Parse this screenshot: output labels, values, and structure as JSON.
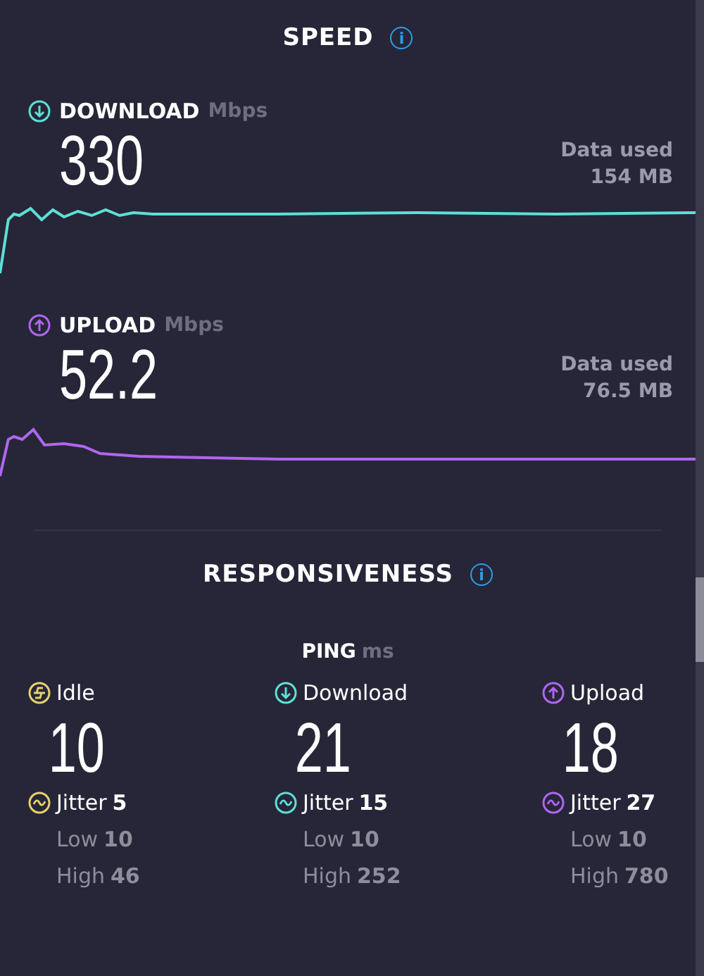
{
  "speed": {
    "title": "SPEED",
    "info": "i",
    "tests": [
      {
        "kind": "download",
        "label": "DOWNLOAD",
        "unit": "Mbps",
        "value": "330",
        "data_used_label": "Data used",
        "data_used": "154 MB",
        "color": "#5ee0d6"
      },
      {
        "kind": "upload",
        "label": "UPLOAD",
        "unit": "Mbps",
        "value": "52.2",
        "data_used_label": "Data used",
        "data_used": "76.5 MB",
        "color": "#b066ee"
      }
    ]
  },
  "responsiveness": {
    "title": "RESPONSIVENESS",
    "info": "i",
    "ping_label": "PING",
    "ping_unit": "ms",
    "columns": [
      {
        "kind": "idle",
        "label": "Idle",
        "value": "10",
        "jitter_label": "Jitter",
        "jitter": "5",
        "low_label": "Low",
        "low": "10",
        "high_label": "High",
        "high": "46",
        "color": "#e6d36a"
      },
      {
        "kind": "download",
        "label": "Download",
        "value": "21",
        "jitter_label": "Jitter",
        "jitter": "15",
        "low_label": "Low",
        "low": "10",
        "high_label": "High",
        "high": "252",
        "color": "#5ee0d6"
      },
      {
        "kind": "upload",
        "label": "Upload",
        "value": "18",
        "jitter_label": "Jitter",
        "jitter": "27",
        "low_label": "Low",
        "low": "10",
        "high_label": "High",
        "high": "780",
        "color": "#b066ee"
      }
    ]
  }
}
